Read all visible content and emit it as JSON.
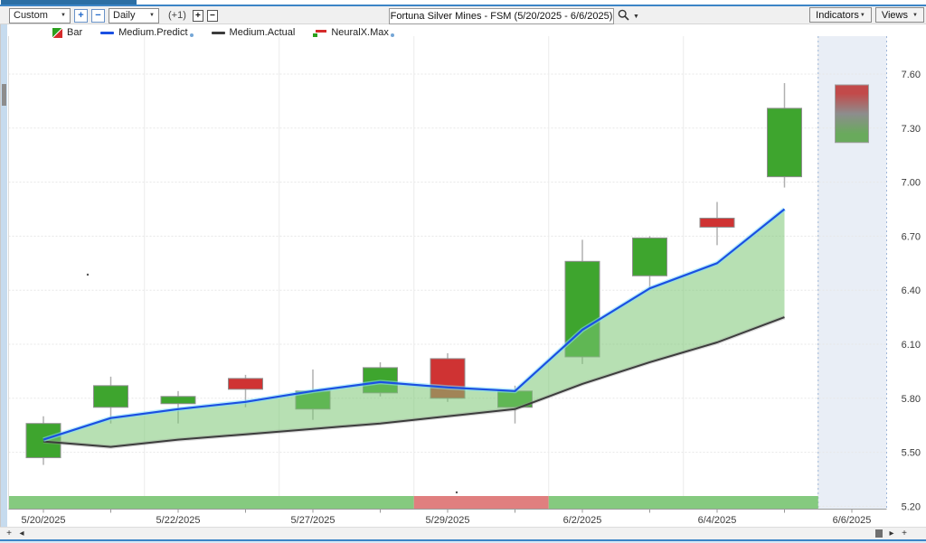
{
  "toolbar": {
    "range_value": "Custom",
    "zoom_in_label": "+",
    "zoom_out_label": "−",
    "period_value": "Daily",
    "offset_label": "(+1)",
    "step_up_label": "+",
    "step_down_label": "−",
    "symbol_title": "Fortuna Silver Mines - FSM (5/20/2025 - 6/6/2025)",
    "indicators_label": "Indicators",
    "views_label": "Views"
  },
  "legend": {
    "items": [
      {
        "label": "Bar"
      },
      {
        "label": "Medium.Predict"
      },
      {
        "label": "Medium.Actual"
      },
      {
        "label": "NeuralX.Max"
      }
    ]
  },
  "scrollbars": {
    "h_add_left": "+",
    "h_left_arrow": "◂",
    "h_right_arrow": "▸",
    "h_add_right": "+"
  },
  "colors": {
    "accent_blue": "#3c85c6",
    "candle_up": "#3ea52e",
    "candle_down": "#cf3333",
    "predict_line": "#1b50e2",
    "actual_line": "#3c3c3c",
    "band_fill": "#7cc674",
    "strip_green": "#85ca7f",
    "strip_red": "#e07f7f",
    "future_zone": "#e9eef6"
  },
  "chart_data": {
    "type": "candlestick",
    "title": "Fortuna Silver Mines - FSM",
    "date_range": "5/20/2025 - 6/6/2025",
    "ylim": [
      5.2,
      7.6
    ],
    "grid": true,
    "y_ticks": [
      7.6,
      7.3,
      7.0,
      6.7,
      6.4,
      6.1,
      5.8,
      5.5,
      5.2
    ],
    "x_tick_labels": [
      "5/20/2025",
      "5/22/2025",
      "5/27/2025",
      "5/29/2025",
      "6/2/2025",
      "6/4/2025",
      "6/6/2025"
    ],
    "x_tick_indices": [
      0,
      2,
      4,
      6,
      8,
      10,
      12
    ],
    "candles": [
      {
        "date": "5/20/2025",
        "open": 5.47,
        "high": 5.7,
        "low": 5.43,
        "close": 5.66
      },
      {
        "date": "5/21/2025",
        "open": 5.75,
        "high": 5.92,
        "low": 5.66,
        "close": 5.87
      },
      {
        "date": "5/22/2025",
        "open": 5.77,
        "high": 5.84,
        "low": 5.66,
        "close": 5.81
      },
      {
        "date": "5/23/2025",
        "open": 5.91,
        "high": 5.93,
        "low": 5.75,
        "close": 5.85
      },
      {
        "date": "5/27/2025",
        "open": 5.74,
        "high": 5.96,
        "low": 5.68,
        "close": 5.84
      },
      {
        "date": "5/28/2025",
        "open": 5.83,
        "high": 6.0,
        "low": 5.81,
        "close": 5.97
      },
      {
        "date": "5/29/2025",
        "open": 6.02,
        "high": 6.05,
        "low": 5.78,
        "close": 5.8
      },
      {
        "date": "5/30/2025",
        "open": 5.75,
        "high": 5.87,
        "low": 5.66,
        "close": 5.84
      },
      {
        "date": "6/2/2025",
        "open": 6.03,
        "high": 6.68,
        "low": 5.99,
        "close": 6.56
      },
      {
        "date": "6/3/2025",
        "open": 6.48,
        "high": 6.7,
        "low": 6.41,
        "close": 6.69
      },
      {
        "date": "6/4/2025",
        "open": 6.8,
        "high": 6.89,
        "low": 6.65,
        "close": 6.75
      },
      {
        "date": "6/5/2025",
        "open": 7.03,
        "high": 7.55,
        "low": 6.97,
        "close": 7.41
      }
    ],
    "series": [
      {
        "name": "Medium.Predict",
        "color": "#1b50e2",
        "values": [
          5.57,
          5.69,
          5.74,
          5.78,
          5.84,
          5.89,
          5.86,
          5.84,
          6.18,
          6.41,
          6.55,
          6.85
        ]
      },
      {
        "name": "Medium.Actual",
        "color": "#3c3c3c",
        "values": [
          5.56,
          5.53,
          5.57,
          5.6,
          5.63,
          5.66,
          5.7,
          5.74,
          5.88,
          6.0,
          6.11,
          6.25
        ]
      }
    ],
    "prediction_bar": {
      "date": "6/6/2025",
      "high": 7.54,
      "low": 7.22,
      "gradient": [
        "#c24a4a",
        "#8d8d8d",
        "#69aa5c"
      ]
    },
    "sentiment_strip": {
      "segments": [
        {
          "color": "green",
          "from_index": 0,
          "to_index": 5
        },
        {
          "color": "red",
          "from_index": 6,
          "to_index": 7
        },
        {
          "color": "green",
          "from_index": 8,
          "to_index": 11
        }
      ]
    },
    "legend_position": "top-left"
  }
}
